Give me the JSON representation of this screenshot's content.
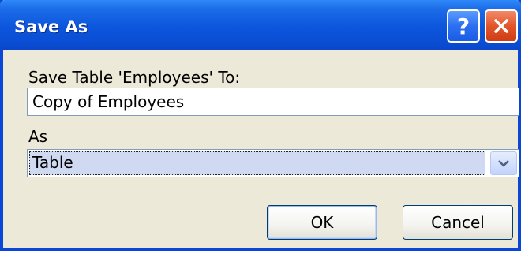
{
  "window": {
    "title": "Save As",
    "help_label": "?"
  },
  "form": {
    "save_label": "Save Table 'Employees' To:",
    "name_value": "Copy of Employees",
    "as_label": "As",
    "as_selected": "Table"
  },
  "buttons": {
    "ok_label": "OK",
    "cancel_label": "Cancel"
  },
  "colors": {
    "titlebar": "#0a4fd6",
    "close_button": "#e2552a",
    "dialog_background": "#ece9d8",
    "selection_highlight": "#cfdaf2"
  },
  "icons": {
    "help": "help-icon",
    "close": "close-icon",
    "dropdown": "chevron-down-icon"
  }
}
